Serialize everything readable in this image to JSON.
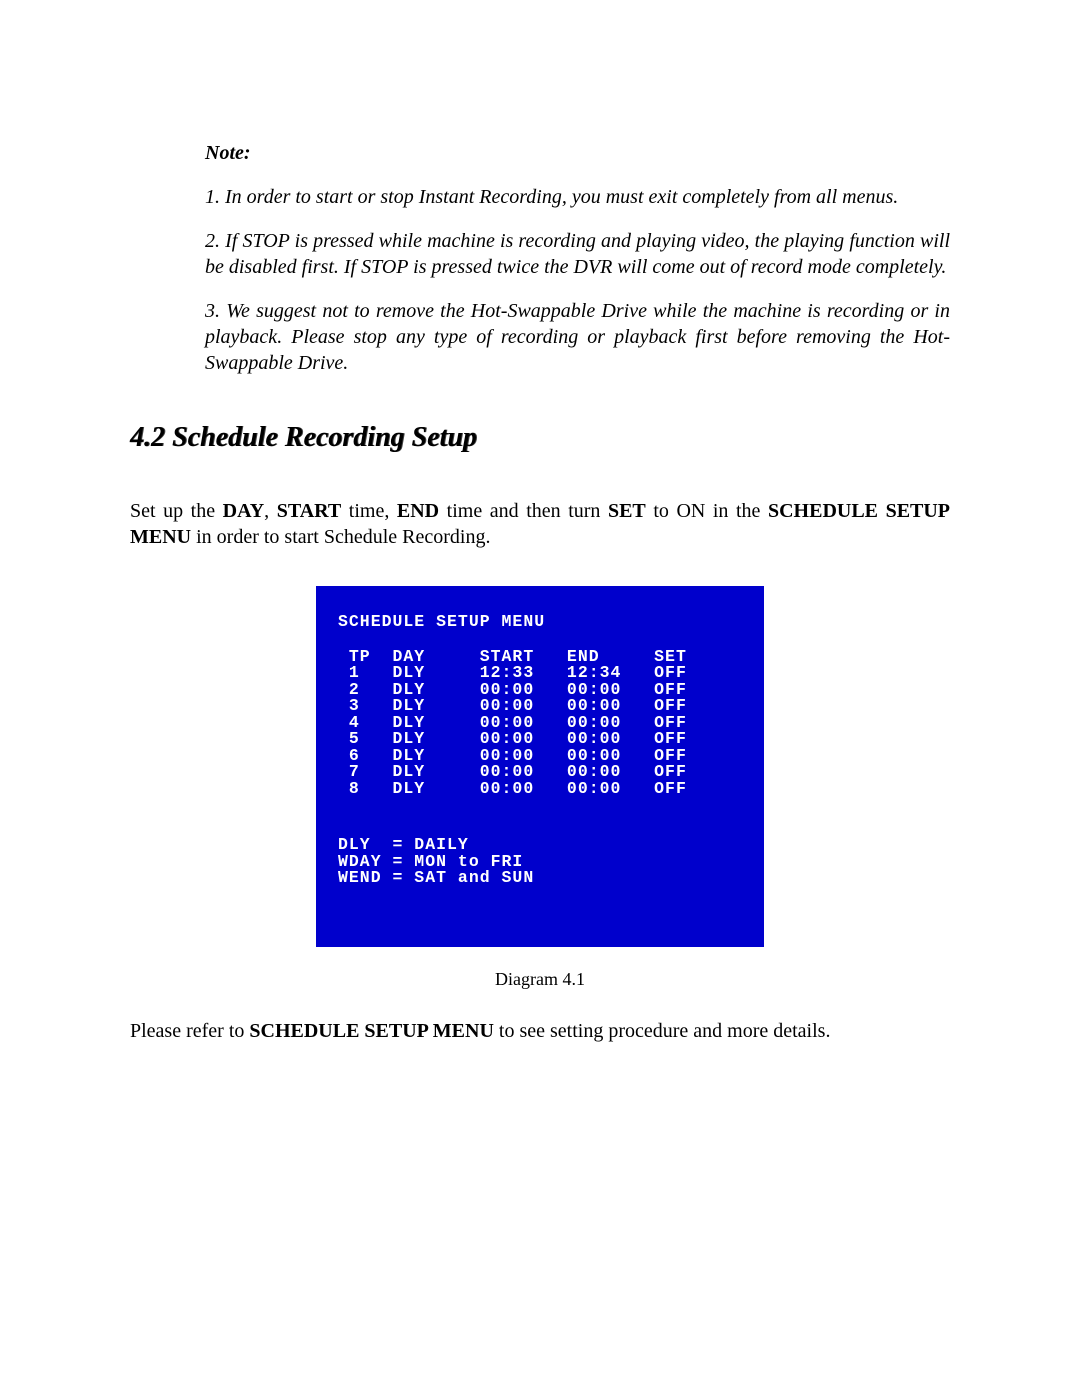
{
  "note": {
    "heading": "Note:",
    "items": [
      "1. In order to start or stop Instant Recording, you must exit completely from all menus.",
      "2. If STOP is pressed while machine is recording and playing video, the playing function will be disabled first. If STOP is pressed twice the DVR will come out of record mode completely.",
      "3. We suggest not to remove the Hot-Swappable Drive while the machine is recording or in playback. Please stop any type of recording or playback first before removing the Hot-Swappable Drive."
    ]
  },
  "section_heading": "4.2 Schedule Recording Setup",
  "intro": {
    "pre": "Set up the ",
    "b1": "DAY",
    "mid1": ", ",
    "b2": "START",
    "mid2": " time, ",
    "b3": "END",
    "mid3": " time and then turn ",
    "b4": "SET",
    "mid4": " to ON in the ",
    "b5": "SCHEDULE SETUP MENU",
    "post": " in order to start Schedule Recording."
  },
  "dvr": {
    "title": "SCHEDULE SETUP MENU",
    "headers": {
      "tp": "TP",
      "day": "DAY",
      "start": "START",
      "end": "END",
      "set": "SET"
    },
    "rows": [
      {
        "tp": "1",
        "day": "DLY",
        "start": "12:33",
        "end": "12:34",
        "set": "OFF"
      },
      {
        "tp": "2",
        "day": "DLY",
        "start": "00:00",
        "end": "00:00",
        "set": "OFF"
      },
      {
        "tp": "3",
        "day": "DLY",
        "start": "00:00",
        "end": "00:00",
        "set": "OFF"
      },
      {
        "tp": "4",
        "day": "DLY",
        "start": "00:00",
        "end": "00:00",
        "set": "OFF"
      },
      {
        "tp": "5",
        "day": "DLY",
        "start": "00:00",
        "end": "00:00",
        "set": "OFF"
      },
      {
        "tp": "6",
        "day": "DLY",
        "start": "00:00",
        "end": "00:00",
        "set": "OFF"
      },
      {
        "tp": "7",
        "day": "DLY",
        "start": "00:00",
        "end": "00:00",
        "set": "OFF"
      },
      {
        "tp": "8",
        "day": "DLY",
        "start": "00:00",
        "end": "00:00",
        "set": "OFF"
      }
    ],
    "legend": [
      {
        "code": "DLY",
        "sep": " = ",
        "desc": "DAILY"
      },
      {
        "code": "WDAY",
        "sep": " = ",
        "desc": "MON to FRI"
      },
      {
        "code": "WEND",
        "sep": " = ",
        "desc": "SAT and SUN"
      }
    ]
  },
  "caption": "Diagram 4.1",
  "after": {
    "pre": "Please refer to ",
    "bold": "SCHEDULE SETUP MENU",
    "post": " to see setting procedure and more details."
  }
}
